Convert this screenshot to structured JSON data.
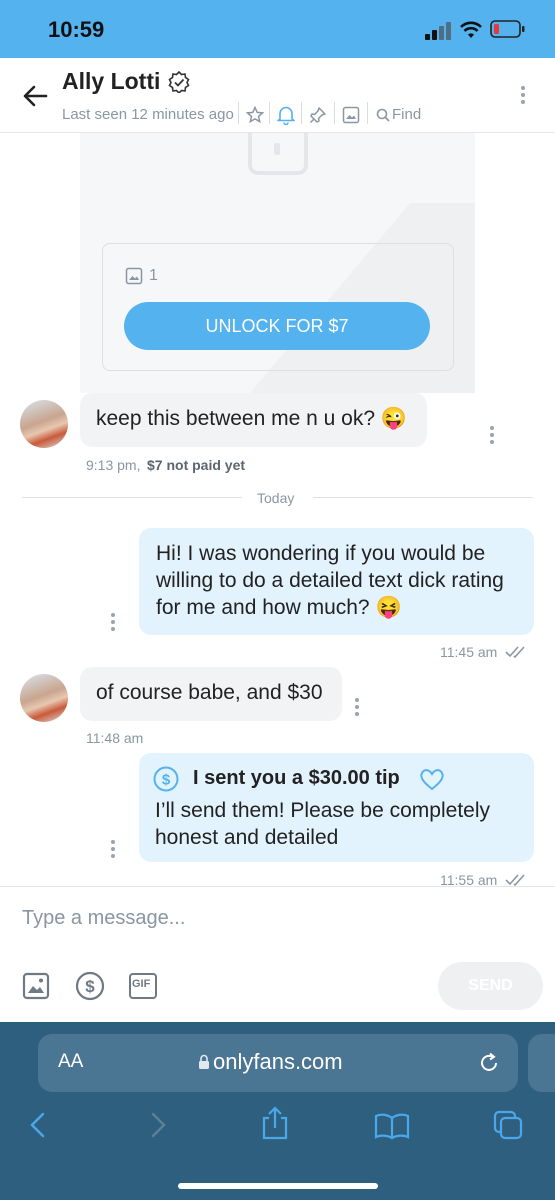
{
  "status_bar": {
    "time": "10:59"
  },
  "header": {
    "name": "Ally Lotti",
    "last_seen": "Last seen 12 minutes ago",
    "find_label": "Find"
  },
  "locked_post": {
    "media_count": "1",
    "unlock_label": "UNLOCK FOR $7"
  },
  "messages": [
    {
      "text": "keep this between me n u ok? 😜",
      "time": "9:13 pm,",
      "status": "$7 not paid yet"
    },
    {
      "text": "Hi! I was wondering if you would be willing to do a detailed text dick rating for me and how much? 😝",
      "time": "11:45 am"
    },
    {
      "text": "of course babe, and $30",
      "time": "11:48 am"
    },
    {
      "tip": "I sent you a $30.00 tip",
      "text": "I’ll send them! Please be completely honest and detailed",
      "time": "11:55 am"
    }
  ],
  "divider": "Today",
  "composer": {
    "placeholder": "Type a message...",
    "send_label": "SEND",
    "gif_label": "GIF"
  },
  "browser": {
    "aa_label": "AA",
    "url": "onlyfans.com"
  },
  "colors": {
    "accent": "#54b2ee",
    "bubble_out": "#e3f3fd",
    "bubble_in": "#f2f3f5",
    "browser_bg": "#2f5f7f"
  }
}
